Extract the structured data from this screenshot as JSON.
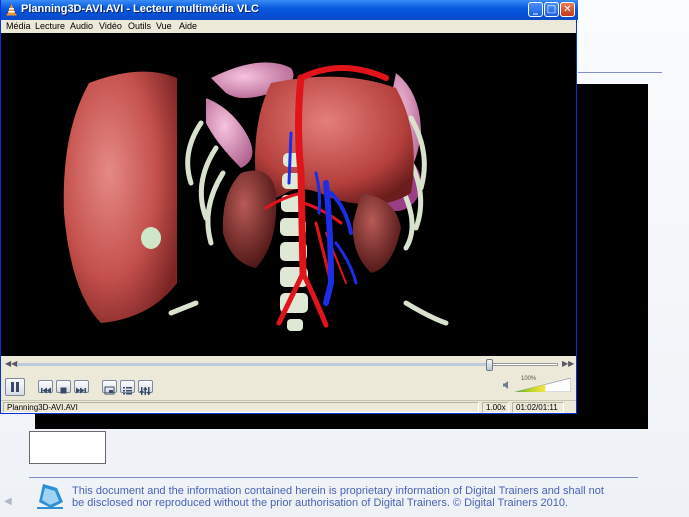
{
  "window": {
    "title": "Planning3D-AVI.AVI - Lecteur multimédia VLC",
    "minimize_glyph": "_",
    "maximize_glyph": "□",
    "close_glyph": "✕"
  },
  "menu": {
    "items": [
      "Média",
      "Lecture",
      "Audio",
      "Vidéo",
      "Outils",
      "Vue",
      "Aide"
    ]
  },
  "playback": {
    "progress_fraction": 0.875,
    "volume_label": "100%",
    "volume_fraction": 1.0
  },
  "status": {
    "filename": "Planning3D-AVI.AVI",
    "speed": "1.00x",
    "time": "01:02/01:11"
  },
  "icons": {
    "title": "vlc-cone-icon",
    "controls": [
      "pause-icon",
      "previous-icon",
      "stop-icon",
      "next-icon",
      "fullscreen-icon",
      "playlist-icon",
      "equalizer-icon",
      "speaker-icon"
    ]
  },
  "colors": {
    "titlebar": "#0a5ce0",
    "footer_text": "#4a63b8",
    "video_bg": "#000000"
  },
  "footer": {
    "text": "This document and the information contained herein is proprietary information of Digital Trainers and shall not be disclosed nor reproduced without the prior authorisation of Digital Trainers.  © Digital Trainers 2010."
  }
}
